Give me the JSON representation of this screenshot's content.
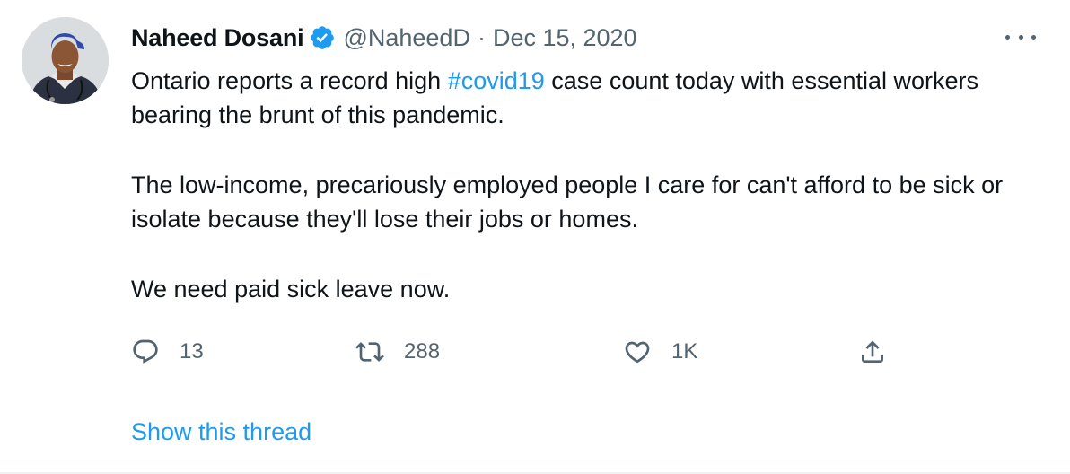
{
  "author": {
    "name": "Naheed Dosani",
    "handle": "@NaheedD",
    "separator": "·",
    "date": "Dec 15, 2020",
    "verified": true
  },
  "tweet": {
    "line1_before": "Ontario reports a record high ",
    "hashtag": "#covid19",
    "line1_after": " case count today with essential workers bearing the brunt of this pandemic.",
    "paragraph2": "The low-income, precariously employed people I care for can't afford to be sick or isolate because they'll lose their jobs or homes.",
    "paragraph3": "We need paid sick leave now."
  },
  "actions": {
    "reply_count": "13",
    "retweet_count": "288",
    "like_count": "1K"
  },
  "show_thread": "Show this thread",
  "icons": {
    "more": "more-icon",
    "reply": "reply-icon",
    "retweet": "retweet-icon",
    "like": "heart-icon",
    "share": "share-icon",
    "verified": "verified-badge-icon"
  },
  "colors": {
    "accent": "#1d9bf0",
    "secondary_text": "#536471",
    "primary_text": "#0f1419"
  }
}
